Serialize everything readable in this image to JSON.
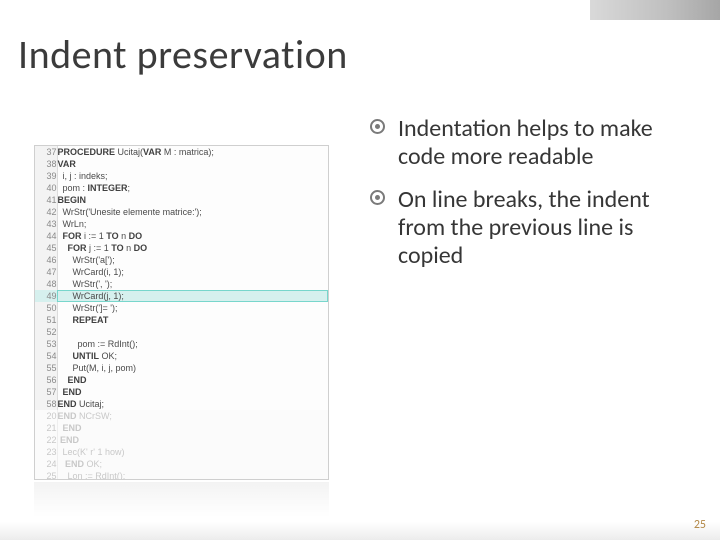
{
  "title": "Indent preservation",
  "bullets": [
    "Indentation helps to make code more readable",
    "On line breaks, the indent from the previous line is copied"
  ],
  "page_number": "25",
  "code": {
    "lines": [
      {
        "n": "37",
        "text": "PROCEDURE Ucitaj(VAR M : matrica);",
        "kw": [
          "PROCEDURE",
          "VAR"
        ],
        "faded": false,
        "hl": false
      },
      {
        "n": "38",
        "text": "VAR",
        "kw": [
          "VAR"
        ],
        "faded": false,
        "hl": false
      },
      {
        "n": "39",
        "text": "  i, j : indeks;",
        "kw": [],
        "faded": false,
        "hl": false
      },
      {
        "n": "40",
        "text": "  pom : INTEGER;",
        "kw": [
          "INTEGER"
        ],
        "faded": false,
        "hl": false
      },
      {
        "n": "41",
        "text": "BEGIN",
        "kw": [
          "BEGIN"
        ],
        "faded": false,
        "hl": false
      },
      {
        "n": "42",
        "text": "  WrStr('Unesite elemente matrice:');",
        "kw": [],
        "faded": false,
        "hl": false
      },
      {
        "n": "43",
        "text": "  WrLn;",
        "kw": [],
        "faded": false,
        "hl": false
      },
      {
        "n": "44",
        "text": "  FOR i := 1 TO n DO",
        "kw": [
          "FOR",
          "TO",
          "DO"
        ],
        "faded": false,
        "hl": false
      },
      {
        "n": "45",
        "text": "    FOR j := 1 TO n DO",
        "kw": [
          "FOR",
          "TO",
          "DO"
        ],
        "faded": false,
        "hl": false
      },
      {
        "n": "46",
        "text": "      WrStr('a[');",
        "kw": [],
        "faded": false,
        "hl": false
      },
      {
        "n": "47",
        "text": "      WrCard(i, 1);",
        "kw": [],
        "faded": false,
        "hl": false
      },
      {
        "n": "48",
        "text": "      WrStr(', ');",
        "kw": [],
        "faded": false,
        "hl": false
      },
      {
        "n": "49",
        "text": "      WrCard(j, 1);",
        "kw": [],
        "faded": false,
        "hl": true
      },
      {
        "n": "50",
        "text": "      WrStr(']= ');",
        "kw": [],
        "faded": false,
        "hl": false
      },
      {
        "n": "51",
        "text": "      REPEAT",
        "kw": [
          "REPEAT"
        ],
        "faded": false,
        "hl": false
      },
      {
        "n": "52",
        "text": "",
        "kw": [],
        "faded": false,
        "hl": false
      },
      {
        "n": "53",
        "text": "        pom := RdInt();",
        "kw": [],
        "faded": false,
        "hl": false
      },
      {
        "n": "54",
        "text": "      UNTIL OK;",
        "kw": [
          "UNTIL"
        ],
        "faded": false,
        "hl": false
      },
      {
        "n": "55",
        "text": "      Put(M, i, j, pom)",
        "kw": [],
        "faded": false,
        "hl": false
      },
      {
        "n": "56",
        "text": "    END",
        "kw": [
          "END"
        ],
        "faded": false,
        "hl": false
      },
      {
        "n": "57",
        "text": "  END",
        "kw": [
          "END"
        ],
        "faded": false,
        "hl": false
      },
      {
        "n": "58",
        "text": "END Ucitaj;",
        "kw": [
          "END"
        ],
        "faded": false,
        "hl": false
      },
      {
        "n": "20",
        "text": "END NCrSW;",
        "kw": [
          "END"
        ],
        "faded": true,
        "hl": false
      },
      {
        "n": "21",
        "text": "  END",
        "kw": [
          "END"
        ],
        "faded": true,
        "hl": false
      },
      {
        "n": "22",
        "text": " END",
        "kw": [
          "END"
        ],
        "faded": true,
        "hl": false
      },
      {
        "n": "23",
        "text": "  Lec(K' r' 1 how)",
        "kw": [],
        "faded": true,
        "hl": false
      },
      {
        "n": "24",
        "text": "   END OK;",
        "kw": [
          "END"
        ],
        "faded": true,
        "hl": false
      },
      {
        "n": "25",
        "text": "    Lon := RdInt();",
        "kw": [],
        "faded": true,
        "hl": false
      }
    ]
  }
}
